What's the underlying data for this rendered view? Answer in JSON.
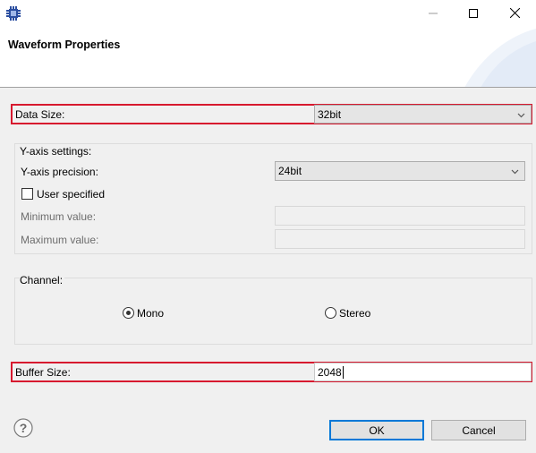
{
  "window": {
    "title": "Waveform Properties",
    "icon": "chip-icon",
    "controls": [
      "minimize-icon",
      "maximize-icon",
      "close-icon"
    ]
  },
  "data_size": {
    "label": "Data Size:",
    "value": "32bit"
  },
  "y_axis": {
    "group_label": "Y-axis settings:",
    "precision_label": "Y-axis precision:",
    "precision_value": "24bit",
    "user_specified_label": "User specified",
    "user_specified_checked": false,
    "minimum_label": "Minimum value:",
    "minimum_value": "",
    "maximum_label": "Maximum value:",
    "maximum_value": ""
  },
  "channel": {
    "group_label": "Channel:",
    "options": [
      {
        "label": "Mono",
        "selected": true
      },
      {
        "label": "Stereo",
        "selected": false
      }
    ]
  },
  "buffer_size": {
    "label": "Buffer Size:",
    "value": "2048"
  },
  "buttons": {
    "ok": "OK",
    "cancel": "Cancel"
  },
  "colors": {
    "highlight_frame": "#d7192f",
    "default_button_border": "#0078d7",
    "dialog_bg": "#f0f0f0"
  }
}
